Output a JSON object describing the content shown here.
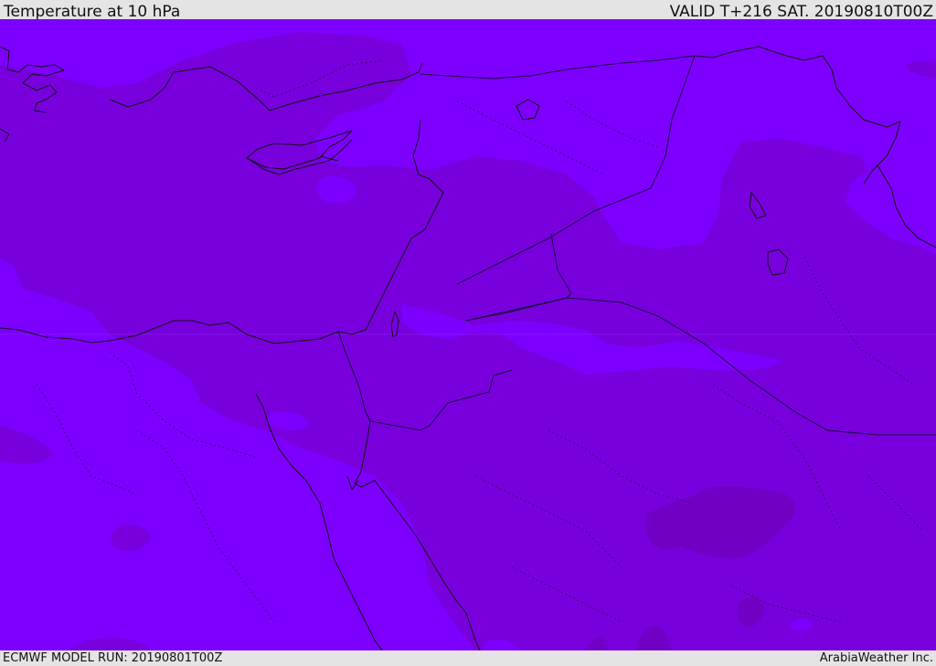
{
  "header": {
    "title": "Temperature at 10 hPa",
    "valid": "VALID T+216 SAT. 20190810T00Z"
  },
  "footer": {
    "model_run": "ECMWF MODEL RUN: 20190801T00Z",
    "credit": "ArabiaWeather Inc."
  },
  "map": {
    "colors": {
      "light_band": "#7d00ff",
      "mid_band": "#7700dd",
      "dark_band": "#7200c4",
      "coastline": "#111111",
      "border": "#2a0050"
    }
  }
}
